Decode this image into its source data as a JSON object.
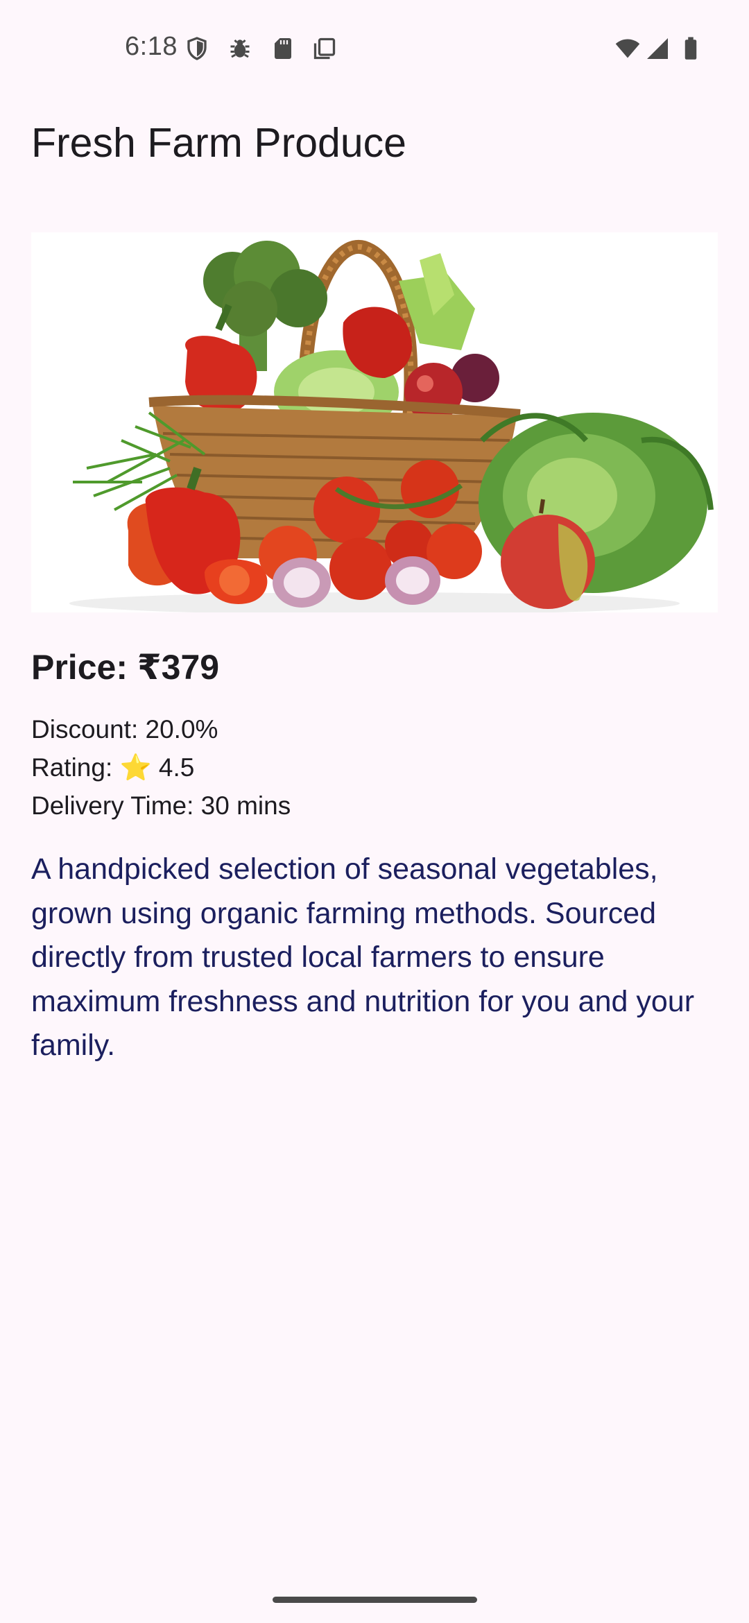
{
  "status_bar": {
    "time": "6:18",
    "icons": [
      "shield-icon",
      "bug-icon",
      "sd-card-icon",
      "copy-icon",
      "wifi-icon",
      "signal-icon",
      "battery-icon"
    ]
  },
  "page": {
    "title": "Fresh Farm Produce"
  },
  "product": {
    "image_alt": "basket-of-vegetables-image",
    "price": "Price: ₹379",
    "discount": "Discount: 20.0%",
    "rating": "Rating: ⭐ 4.5",
    "delivery": "Delivery Time: 30 mins",
    "description": "A handpicked selection of seasonal vegetables, grown using organic farming methods. Sourced directly from trusted local farmers to ensure maximum freshness and nutrition for you and your family."
  },
  "colors": {
    "background": "#fef7fc",
    "text_primary": "#1d1b20",
    "description_text": "#1b1f5e"
  }
}
